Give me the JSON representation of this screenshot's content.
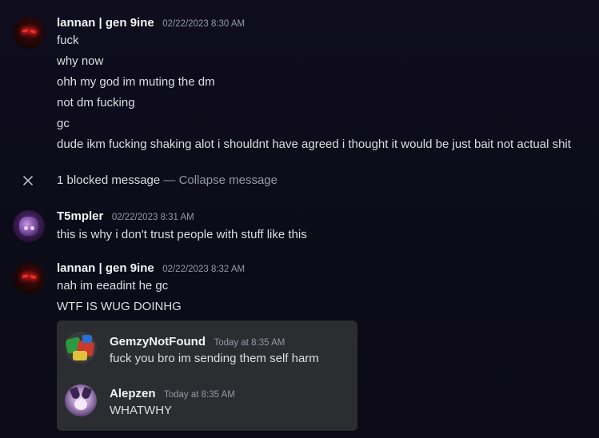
{
  "groups": [
    {
      "username": "lannan | gen 9ine",
      "timestamp": "02/22/2023 8:30 AM",
      "lines": [
        "fuck",
        "why now",
        "ohh my god im muting the dm",
        "not dm fucking",
        "gc",
        "dude ikm fucking shaking alot i shouldnt have agreed i thought it would be just bait not actual shit"
      ]
    },
    {
      "username": "T5mpler",
      "timestamp": "02/22/2023 8:31 AM",
      "lines": [
        "this is why i don't trust people with stuff like this"
      ]
    },
    {
      "username": "lannan | gen 9ine",
      "timestamp": "02/22/2023 8:32 AM",
      "lines": [
        "nah im eeadint he gc",
        "WTF IS WUG DOINHG"
      ]
    }
  ],
  "blocked": {
    "count_text": "1 blocked message",
    "separator": " — ",
    "collapse_label": "Collapse message"
  },
  "embed": {
    "messages": [
      {
        "username": "GemzyNotFound",
        "timestamp": "Today at 8:35 AM",
        "text": "fuck you bro im sending them self harm"
      },
      {
        "username": "Alepzen",
        "timestamp": "Today at 8:35 AM",
        "text": "WHATWHY"
      }
    ]
  },
  "icons": {
    "collapse": "close-icon"
  },
  "colors": {
    "background": "#0f0d1e",
    "username": "#f2f3f5",
    "timestamp": "#949ba4",
    "text": "#dbdee1",
    "embed_background": "#2b2d31"
  }
}
